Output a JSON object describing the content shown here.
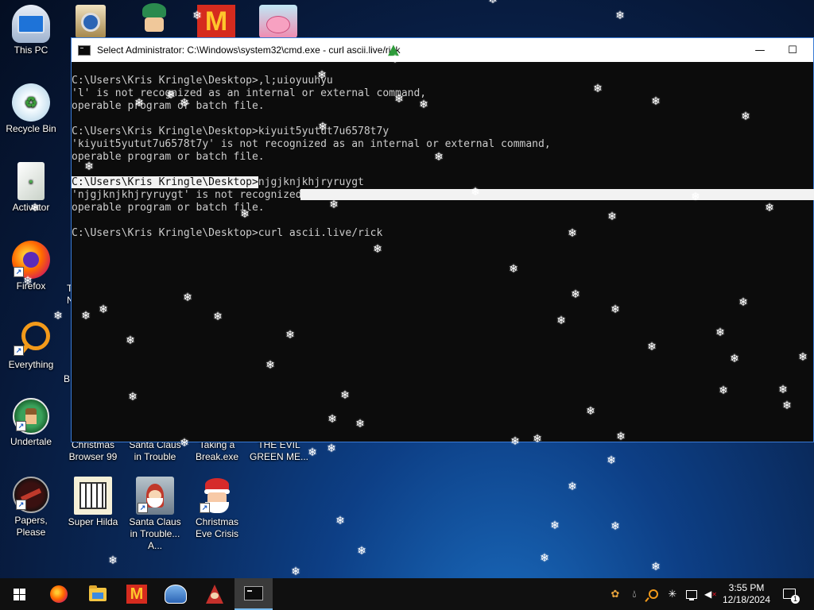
{
  "desktop": {
    "icons": [
      {
        "label": "This PC",
        "icon": "this-pc-icon"
      },
      {
        "label": "Recycle Bin",
        "icon": "recycle-bin-icon"
      },
      {
        "label": "Activator",
        "icon": "activator-icon"
      },
      {
        "label": "Firefox",
        "icon": "firefox-icon"
      },
      {
        "label": "Everything",
        "icon": "everything-search-icon"
      },
      {
        "label": "Undertale",
        "icon": "undertale-icon"
      },
      {
        "label": "Papers, Please",
        "icon": "papers-please-icon"
      },
      {
        "label": "Christmas Browser 99",
        "icon": "christmas-browser-icon"
      },
      {
        "label": "Santa Claus in Trouble",
        "icon": "santa-claus-trouble-icon"
      },
      {
        "label": "Taking a Break.exe",
        "icon": "taking-a-break-icon"
      },
      {
        "label": "THE EVIL GREEN ME...",
        "icon": "evil-green-icon"
      },
      {
        "label": "Super Hilda",
        "icon": "super-hilda-icon"
      },
      {
        "label": "Santa Claus in Trouble... A...",
        "icon": "santa-claus-trouble-again-icon"
      },
      {
        "label": "Christmas Eve Crisis",
        "icon": "christmas-eve-crisis-icon"
      }
    ],
    "partial_labels": {
      "t1": "T",
      "t2": "N",
      "b": "B"
    }
  },
  "console": {
    "title": "Select Administrator: C:\\Windows\\system32\\cmd.exe - curl  ascii.live/rick",
    "minimize_glyph": "—",
    "maximize_glyph": "☐",
    "lines": [
      "",
      "C:\\Users\\Kris Kringle\\Desktop>,l;uioyuuhyu",
      "'l' is not recognized as an internal or external command,",
      "operable program or batch file.",
      "",
      "C:\\Users\\Kris Kringle\\Desktop>kiyuit5yutut7u6578t7y",
      "'kiyuit5yutut7u6578t7y' is not recognized as an internal or external command,",
      "operable program or batch file.",
      "",
      "C:\\Users\\Kris Kringle\\Desktop>",
      "'njgjknjkhjryruygt' is not recognized as an internal or external command,",
      "operable program or batch file.",
      "",
      "C:\\Users\\Kris Kringle\\Desktop>curl ascii.live/rick"
    ],
    "selected_prefix": "C:\\Users\\Kris Kringle\\Desktop>",
    "selected_rest": "njgjknjkhjryruygt"
  },
  "taskbar": {
    "start_icon": "windows-start-icon",
    "apps": [
      "firefox-icon",
      "file-explorer-icon",
      "mcdonalds-icon",
      "game-icon",
      "santa-icon",
      "command-prompt-icon"
    ],
    "tray": [
      "people-icon",
      "water-drop-icon",
      "search-icon",
      "snowflake-icon",
      "network-icon",
      "volume-muted-icon"
    ],
    "time": "3:55 PM",
    "date": "12/18/2024",
    "notification_count": "1"
  }
}
